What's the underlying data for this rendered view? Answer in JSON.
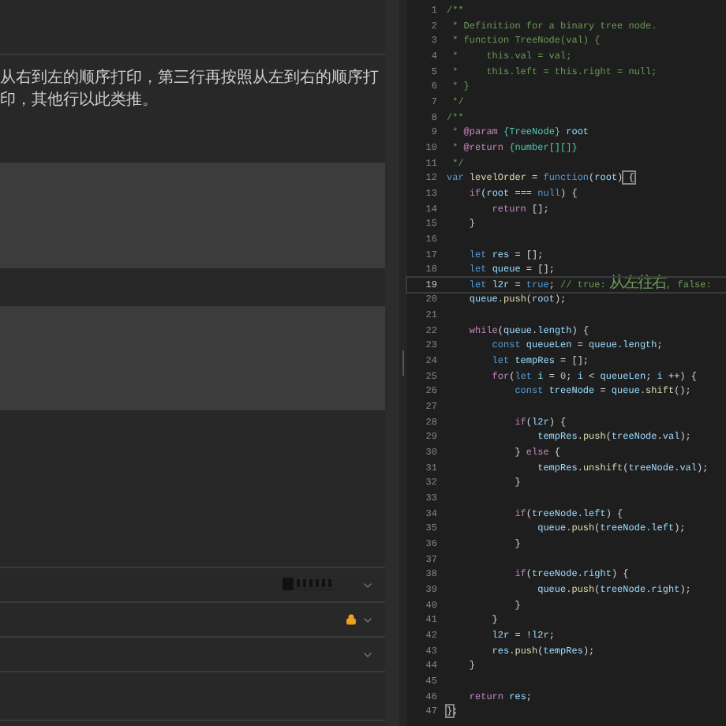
{
  "problem": {
    "text": "从右到左的顺序打印，第三行再按照从左到右的顺序打印，其他行以此类推。"
  },
  "sections": [
    {
      "kind": "logo"
    },
    {
      "kind": "locked"
    },
    {
      "kind": "plain"
    }
  ],
  "editor": {
    "lines": [
      {
        "number": "1",
        "current": false,
        "segments": [
          {
            "kind": "comment",
            "text": "/**"
          }
        ]
      },
      {
        "number": "2",
        "current": false,
        "segments": [
          {
            "kind": "comment",
            "text": " * Definition for a binary tree node."
          }
        ]
      },
      {
        "number": "3",
        "current": false,
        "segments": [
          {
            "kind": "comment",
            "text": " * function TreeNode(val) {"
          }
        ]
      },
      {
        "number": "4",
        "current": false,
        "segments": [
          {
            "kind": "comment",
            "text": " *     this.val = val;"
          }
        ]
      },
      {
        "number": "5",
        "current": false,
        "segments": [
          {
            "kind": "comment",
            "text": " *     this.left = this.right = null;"
          }
        ]
      },
      {
        "number": "6",
        "current": false,
        "segments": [
          {
            "kind": "comment",
            "text": " * }"
          }
        ]
      },
      {
        "number": "7",
        "current": false,
        "segments": [
          {
            "kind": "comment",
            "text": " */"
          }
        ]
      },
      {
        "number": "8",
        "current": false,
        "segments": [
          {
            "kind": "comment",
            "text": "/**"
          }
        ]
      },
      {
        "number": "9",
        "current": false,
        "segments": [
          {
            "kind": "comment",
            "text": " *"
          },
          {
            "kind": "tag",
            "text": " @param"
          },
          {
            "kind": "type",
            "text": " {TreeNode}"
          },
          {
            "kind": "variable",
            "text": " root"
          }
        ]
      },
      {
        "number": "10",
        "current": false,
        "segments": [
          {
            "kind": "comment",
            "text": " *"
          },
          {
            "kind": "tag",
            "text": " @return"
          },
          {
            "kind": "type",
            "text": " {number[][]}"
          }
        ]
      },
      {
        "number": "11",
        "current": false,
        "segments": [
          {
            "kind": "comment",
            "text": " */"
          }
        ]
      },
      {
        "number": "12",
        "current": false,
        "segments": [
          {
            "kind": "keyword",
            "text": "var"
          },
          {
            "kind": "function",
            "text": " levelOrder"
          },
          {
            "kind": "plain",
            "text": " ="
          },
          {
            "kind": "keyword",
            "text": " function"
          },
          {
            "kind": "plain",
            "text": "("
          },
          {
            "kind": "variable",
            "text": "root"
          },
          {
            "kind": "plain",
            "text": ")"
          },
          {
            "kind": "match",
            "text": " {"
          }
        ]
      },
      {
        "number": "13",
        "current": false,
        "segments": [
          {
            "kind": "control",
            "text": "    if"
          },
          {
            "kind": "plain",
            "text": "("
          },
          {
            "kind": "variable",
            "text": "root"
          },
          {
            "kind": "plain",
            "text": " ==="
          },
          {
            "kind": "keyword",
            "text": " null"
          },
          {
            "kind": "plain",
            "text": ") {"
          }
        ]
      },
      {
        "number": "14",
        "current": false,
        "segments": [
          {
            "kind": "control",
            "text": "        return"
          },
          {
            "kind": "plain",
            "text": " [];"
          }
        ]
      },
      {
        "number": "15",
        "current": false,
        "segments": [
          {
            "kind": "plain",
            "text": "    }"
          }
        ]
      },
      {
        "number": "16",
        "current": false
      },
      {
        "number": "17",
        "current": false,
        "segments": [
          {
            "kind": "keyword",
            "text": "    let"
          },
          {
            "kind": "variable",
            "text": " res"
          },
          {
            "kind": "plain",
            "text": " = [];"
          }
        ]
      },
      {
        "number": "18",
        "current": false,
        "segments": [
          {
            "kind": "keyword",
            "text": "    let"
          },
          {
            "kind": "variable",
            "text": " queue"
          },
          {
            "kind": "plain",
            "text": " = [];"
          }
        ]
      },
      {
        "number": "19",
        "current": true,
        "segments": [
          {
            "kind": "keyword",
            "text": "    let"
          },
          {
            "kind": "variable",
            "text": " l2r"
          },
          {
            "kind": "plain",
            "text": " ="
          },
          {
            "kind": "keyword",
            "text": " true"
          },
          {
            "kind": "plain",
            "text": ";"
          },
          {
            "kind": "comment",
            "text": " // true:"
          },
          {
            "kind": "comment-cjk",
            "text": " 从左往右"
          },
          {
            "kind": "comment",
            "text": ", false:"
          }
        ]
      },
      {
        "number": "20",
        "current": false,
        "segments": [
          {
            "kind": "variable",
            "text": "    queue"
          },
          {
            "kind": "plain",
            "text": "."
          },
          {
            "kind": "function",
            "text": "push"
          },
          {
            "kind": "plain",
            "text": "("
          },
          {
            "kind": "variable",
            "text": "root"
          },
          {
            "kind": "plain",
            "text": ");"
          }
        ]
      },
      {
        "number": "21",
        "current": false
      },
      {
        "number": "22",
        "current": false,
        "segments": [
          {
            "kind": "control",
            "text": "    while"
          },
          {
            "kind": "plain",
            "text": "("
          },
          {
            "kind": "variable",
            "text": "queue"
          },
          {
            "kind": "plain",
            "text": "."
          },
          {
            "kind": "variable",
            "text": "length"
          },
          {
            "kind": "plain",
            "text": ") {"
          }
        ]
      },
      {
        "number": "23",
        "current": false,
        "segments": [
          {
            "kind": "keyword",
            "text": "        const"
          },
          {
            "kind": "variable",
            "text": " queueLen"
          },
          {
            "kind": "plain",
            "text": " ="
          },
          {
            "kind": "variable",
            "text": " queue"
          },
          {
            "kind": "plain",
            "text": "."
          },
          {
            "kind": "variable",
            "text": "length"
          },
          {
            "kind": "plain",
            "text": ";"
          }
        ]
      },
      {
        "number": "24",
        "current": false,
        "segments": [
          {
            "kind": "keyword",
            "text": "        let"
          },
          {
            "kind": "variable",
            "text": " tempRes"
          },
          {
            "kind": "plain",
            "text": " = [];"
          }
        ]
      },
      {
        "number": "25",
        "current": false,
        "segments": [
          {
            "kind": "control",
            "text": "        for"
          },
          {
            "kind": "plain",
            "text": "("
          },
          {
            "kind": "keyword",
            "text": "let"
          },
          {
            "kind": "variable",
            "text": " i"
          },
          {
            "kind": "plain",
            "text": " ="
          },
          {
            "kind": "number",
            "text": " 0"
          },
          {
            "kind": "plain",
            "text": ";"
          },
          {
            "kind": "variable",
            "text": " i"
          },
          {
            "kind": "plain",
            "text": " <"
          },
          {
            "kind": "variable",
            "text": " queueLen"
          },
          {
            "kind": "plain",
            "text": ";"
          },
          {
            "kind": "variable",
            "text": " i"
          },
          {
            "kind": "plain",
            "text": " ++) {"
          }
        ]
      },
      {
        "number": "26",
        "current": false,
        "segments": [
          {
            "kind": "keyword",
            "text": "            const"
          },
          {
            "kind": "variable",
            "text": " treeNode"
          },
          {
            "kind": "plain",
            "text": " ="
          },
          {
            "kind": "variable",
            "text": " queue"
          },
          {
            "kind": "plain",
            "text": "."
          },
          {
            "kind": "function",
            "text": "shift"
          },
          {
            "kind": "plain",
            "text": "();"
          }
        ]
      },
      {
        "number": "27",
        "current": false
      },
      {
        "number": "28",
        "current": false,
        "segments": [
          {
            "kind": "control",
            "text": "            if"
          },
          {
            "kind": "plain",
            "text": "("
          },
          {
            "kind": "variable",
            "text": "l2r"
          },
          {
            "kind": "plain",
            "text": ") {"
          }
        ]
      },
      {
        "number": "29",
        "current": false,
        "segments": [
          {
            "kind": "variable",
            "text": "                tempRes"
          },
          {
            "kind": "plain",
            "text": "."
          },
          {
            "kind": "function",
            "text": "push"
          },
          {
            "kind": "plain",
            "text": "("
          },
          {
            "kind": "variable",
            "text": "treeNode"
          },
          {
            "kind": "plain",
            "text": "."
          },
          {
            "kind": "variable",
            "text": "val"
          },
          {
            "kind": "plain",
            "text": ");"
          }
        ]
      },
      {
        "number": "30",
        "current": false,
        "segments": [
          {
            "kind": "plain",
            "text": "            }"
          },
          {
            "kind": "control",
            "text": " else"
          },
          {
            "kind": "plain",
            "text": " {"
          }
        ]
      },
      {
        "number": "31",
        "current": false,
        "segments": [
          {
            "kind": "variable",
            "text": "                tempRes"
          },
          {
            "kind": "plain",
            "text": "."
          },
          {
            "kind": "function",
            "text": "unshift"
          },
          {
            "kind": "plain",
            "text": "("
          },
          {
            "kind": "variable",
            "text": "treeNode"
          },
          {
            "kind": "plain",
            "text": "."
          },
          {
            "kind": "variable",
            "text": "val"
          },
          {
            "kind": "plain",
            "text": ");"
          }
        ]
      },
      {
        "number": "32",
        "current": false,
        "segments": [
          {
            "kind": "plain",
            "text": "            }"
          }
        ]
      },
      {
        "number": "33",
        "current": false
      },
      {
        "number": "34",
        "current": false,
        "segments": [
          {
            "kind": "control",
            "text": "            if"
          },
          {
            "kind": "plain",
            "text": "("
          },
          {
            "kind": "variable",
            "text": "treeNode"
          },
          {
            "kind": "plain",
            "text": "."
          },
          {
            "kind": "variable",
            "text": "left"
          },
          {
            "kind": "plain",
            "text": ") {"
          }
        ]
      },
      {
        "number": "35",
        "current": false,
        "segments": [
          {
            "kind": "variable",
            "text": "                queue"
          },
          {
            "kind": "plain",
            "text": "."
          },
          {
            "kind": "function",
            "text": "push"
          },
          {
            "kind": "plain",
            "text": "("
          },
          {
            "kind": "variable",
            "text": "treeNode"
          },
          {
            "kind": "plain",
            "text": "."
          },
          {
            "kind": "variable",
            "text": "left"
          },
          {
            "kind": "plain",
            "text": ");"
          }
        ]
      },
      {
        "number": "36",
        "current": false,
        "segments": [
          {
            "kind": "plain",
            "text": "            }"
          }
        ]
      },
      {
        "number": "37",
        "current": false
      },
      {
        "number": "38",
        "current": false,
        "segments": [
          {
            "kind": "control",
            "text": "            if"
          },
          {
            "kind": "plain",
            "text": "("
          },
          {
            "kind": "variable",
            "text": "treeNode"
          },
          {
            "kind": "plain",
            "text": "."
          },
          {
            "kind": "variable",
            "text": "right"
          },
          {
            "kind": "plain",
            "text": ") {"
          }
        ]
      },
      {
        "number": "39",
        "current": false,
        "segments": [
          {
            "kind": "variable",
            "text": "                queue"
          },
          {
            "kind": "plain",
            "text": "."
          },
          {
            "kind": "function",
            "text": "push"
          },
          {
            "kind": "plain",
            "text": "("
          },
          {
            "kind": "variable",
            "text": "treeNode"
          },
          {
            "kind": "plain",
            "text": "."
          },
          {
            "kind": "variable",
            "text": "right"
          },
          {
            "kind": "plain",
            "text": ");"
          }
        ]
      },
      {
        "number": "40",
        "current": false,
        "segments": [
          {
            "kind": "plain",
            "text": "            }"
          }
        ]
      },
      {
        "number": "41",
        "current": false,
        "segments": [
          {
            "kind": "plain",
            "text": "        }"
          }
        ]
      },
      {
        "number": "42",
        "current": false,
        "segments": [
          {
            "kind": "variable",
            "text": "        l2r"
          },
          {
            "kind": "plain",
            "text": " = !"
          },
          {
            "kind": "variable",
            "text": "l2r"
          },
          {
            "kind": "plain",
            "text": ";"
          }
        ]
      },
      {
        "number": "43",
        "current": false,
        "segments": [
          {
            "kind": "variable",
            "text": "        res"
          },
          {
            "kind": "plain",
            "text": "."
          },
          {
            "kind": "function",
            "text": "push"
          },
          {
            "kind": "plain",
            "text": "("
          },
          {
            "kind": "variable",
            "text": "tempRes"
          },
          {
            "kind": "plain",
            "text": ");"
          }
        ]
      },
      {
        "number": "44",
        "current": false,
        "segments": [
          {
            "kind": "plain",
            "text": "    }"
          }
        ]
      },
      {
        "number": "45",
        "current": false
      },
      {
        "number": "46",
        "current": false,
        "segments": [
          {
            "kind": "control",
            "text": "    return"
          },
          {
            "kind": "variable",
            "text": " res"
          },
          {
            "kind": "plain",
            "text": ";"
          }
        ]
      },
      {
        "number": "47",
        "current": false,
        "segments": [
          {
            "kind": "match",
            "text": "}"
          },
          {
            "kind": "plain",
            "text": ";"
          }
        ]
      }
    ]
  }
}
